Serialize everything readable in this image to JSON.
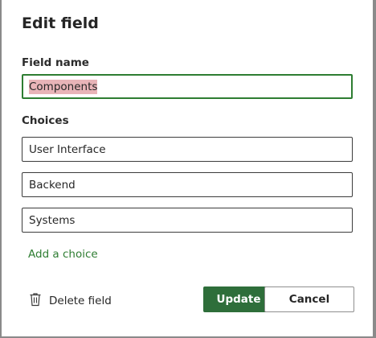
{
  "dialog": {
    "title": "Edit field",
    "field_name_label": "Field name",
    "field_name_value": "Components",
    "choices_label": "Choices",
    "choices": [
      "User Interface",
      "Backend",
      "Systems"
    ],
    "add_choice_label": "Add a choice",
    "delete_label": "Delete field",
    "update_label": "Update",
    "cancel_label": "Cancel",
    "icons": {
      "delete": "trash-icon"
    },
    "colors": {
      "accent": "#2e6e3a",
      "link": "#2e7d32",
      "selection": "#e8b4b8"
    }
  }
}
